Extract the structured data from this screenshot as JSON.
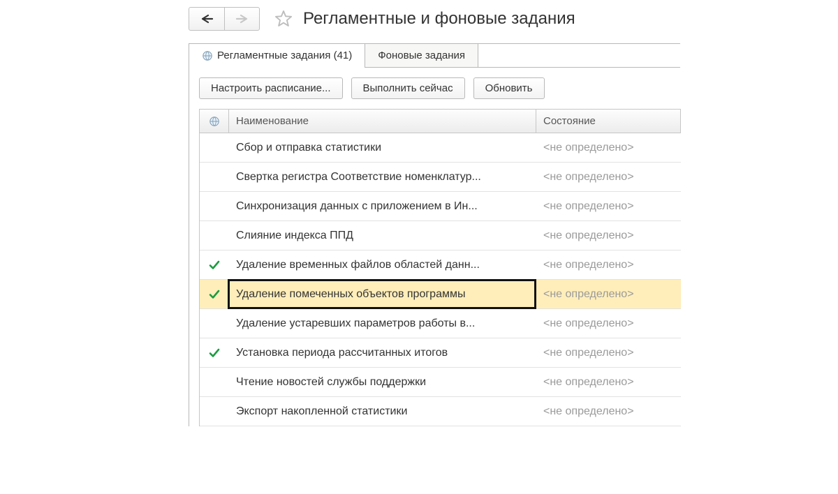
{
  "header": {
    "title": "Регламентные и фоновые задания"
  },
  "tabs": [
    {
      "label": "Регламентные задания (41)",
      "active": true,
      "hasGlobe": true
    },
    {
      "label": "Фоновые задания",
      "active": false,
      "hasGlobe": false
    }
  ],
  "toolbar": {
    "schedule": "Настроить расписание...",
    "run_now": "Выполнить сейчас",
    "refresh": "Обновить"
  },
  "table": {
    "columns": {
      "name": "Наименование",
      "state": "Состояние"
    },
    "rows": [
      {
        "name": "Сбор и отправка статистики",
        "state": "<не определено>",
        "checked": false,
        "selected": false
      },
      {
        "name": "Свертка регистра Соответствие номенклатур...",
        "state": "<не определено>",
        "checked": false,
        "selected": false
      },
      {
        "name": "Синхронизация данных с приложением в Ин...",
        "state": "<не определено>",
        "checked": false,
        "selected": false
      },
      {
        "name": "Слияние индекса ППД",
        "state": "<не определено>",
        "checked": false,
        "selected": false
      },
      {
        "name": "Удаление временных файлов областей данн...",
        "state": "<не определено>",
        "checked": true,
        "selected": false
      },
      {
        "name": "Удаление помеченных объектов программы",
        "state": "<не определено>",
        "checked": true,
        "selected": true
      },
      {
        "name": "Удаление устаревших параметров работы в...",
        "state": "<не определено>",
        "checked": false,
        "selected": false
      },
      {
        "name": "Установка периода рассчитанных итогов",
        "state": "<не определено>",
        "checked": true,
        "selected": false
      },
      {
        "name": "Чтение новостей службы поддержки",
        "state": "<не определено>",
        "checked": false,
        "selected": false
      },
      {
        "name": "Экспорт накопленной статистики",
        "state": "<не определено>",
        "checked": false,
        "selected": false
      }
    ]
  }
}
